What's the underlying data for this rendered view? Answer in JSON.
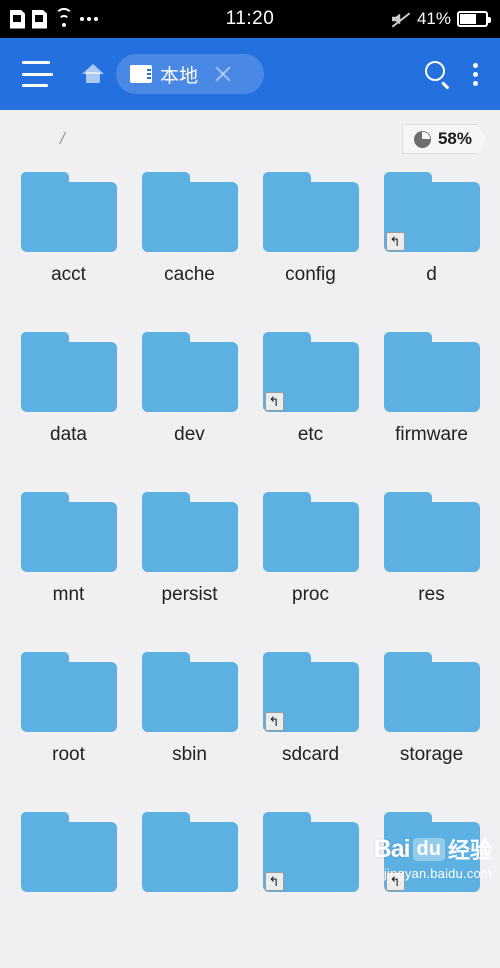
{
  "status_bar": {
    "time": "11:20",
    "battery_percent": "41%",
    "icons": [
      "sim1-icon",
      "sim2-icon",
      "wifi-icon",
      "more-dots-icon",
      "mute-icon",
      "battery-icon"
    ]
  },
  "app_bar": {
    "menu_icon": "hamburger-menu-icon",
    "home_icon": "home-icon",
    "tab": {
      "icon": "sd-card-icon",
      "label": "本地",
      "close_icon": "close-icon"
    },
    "search_icon": "search-icon",
    "overflow_icon": "overflow-menu-icon"
  },
  "breadcrumb": {
    "path": "/"
  },
  "storage": {
    "icon": "pie-chart-icon",
    "percent": "58%"
  },
  "files": [
    {
      "name": "acct",
      "type": "folder",
      "link": false
    },
    {
      "name": "cache",
      "type": "folder",
      "link": false
    },
    {
      "name": "config",
      "type": "folder",
      "link": false
    },
    {
      "name": "d",
      "type": "folder",
      "link": true
    },
    {
      "name": "data",
      "type": "folder",
      "link": false
    },
    {
      "name": "dev",
      "type": "folder",
      "link": false
    },
    {
      "name": "etc",
      "type": "folder",
      "link": true
    },
    {
      "name": "firmware",
      "type": "folder",
      "link": false
    },
    {
      "name": "mnt",
      "type": "folder",
      "link": false
    },
    {
      "name": "persist",
      "type": "folder",
      "link": false
    },
    {
      "name": "proc",
      "type": "folder",
      "link": false
    },
    {
      "name": "res",
      "type": "folder",
      "link": false
    },
    {
      "name": "root",
      "type": "folder",
      "link": false
    },
    {
      "name": "sbin",
      "type": "folder",
      "link": false
    },
    {
      "name": "sdcard",
      "type": "folder",
      "link": true
    },
    {
      "name": "storage",
      "type": "folder",
      "link": false
    },
    {
      "name": "",
      "type": "folder",
      "link": false,
      "cut": true
    },
    {
      "name": "",
      "type": "folder",
      "link": false,
      "cut": true
    },
    {
      "name": "",
      "type": "folder",
      "link": true,
      "cut": true
    },
    {
      "name": "",
      "type": "folder",
      "link": true,
      "cut": true
    }
  ],
  "watermark": {
    "brand_bai": "Bai",
    "brand_du": "du",
    "brand_cn": "经验",
    "url": "jingyan.baidu.com"
  },
  "colors": {
    "app_bar": "#2570df",
    "folder": "#5cb1e2",
    "background": "#f0eff1",
    "status_bar": "#000000"
  }
}
